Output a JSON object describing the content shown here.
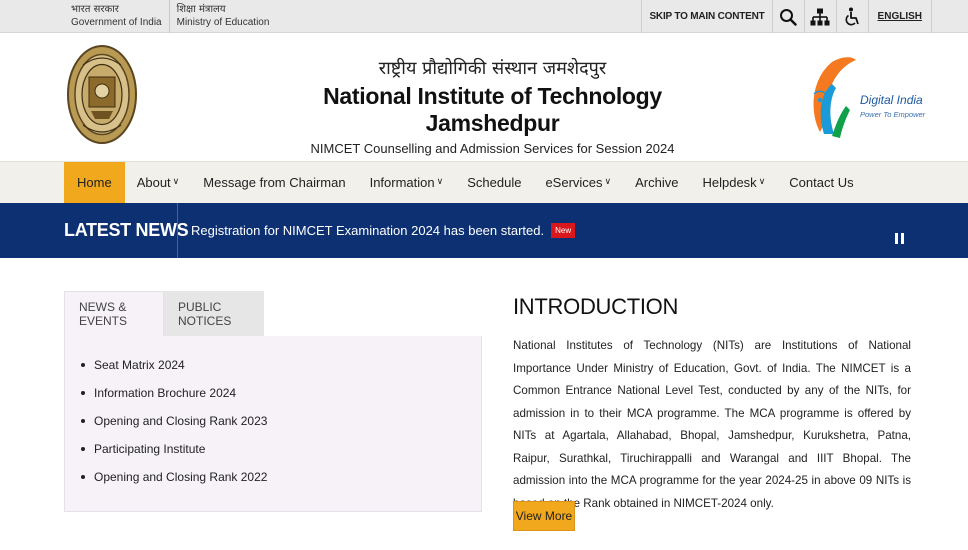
{
  "gov_bar": {
    "gov_hindi": "भारत सरकार",
    "gov_english": "Government of India",
    "ministry_hindi": "शिक्षा मंत्रालय",
    "ministry_english": "Ministry of Education",
    "skip_label": "SKIP TO MAIN CONTENT",
    "icons": [
      "search-icon",
      "sitemap-icon",
      "accessibility-icon"
    ],
    "language_label": "ENGLISH"
  },
  "header": {
    "hindi_title": "राष्ट्रीय प्रौद्योगिकी संस्थान जमशेदपुर",
    "title": "National Institute of Technology Jamshedpur",
    "subtitle": "NIMCET Counselling and Admission Services for Session 2024",
    "digital_india": "Digital India",
    "digital_india_tagline": "Power To Empower"
  },
  "nav": {
    "items": [
      {
        "label": "Home",
        "dropdown": false,
        "active": true
      },
      {
        "label": "About",
        "dropdown": true
      },
      {
        "label": "Message from Chairman",
        "dropdown": false
      },
      {
        "label": "Information",
        "dropdown": true
      },
      {
        "label": "Schedule",
        "dropdown": false
      },
      {
        "label": "eServices",
        "dropdown": true
      },
      {
        "label": "Archive",
        "dropdown": false
      },
      {
        "label": "Helpdesk",
        "dropdown": true
      },
      {
        "label": "Contact Us",
        "dropdown": false
      }
    ]
  },
  "news": {
    "label": "LATEST NEWS",
    "headline": "Registration for NIMCET Examination 2024 has been started.",
    "badge": "New"
  },
  "tabs": {
    "items": [
      {
        "label": "NEWS & EVENTS",
        "active": true
      },
      {
        "label": "PUBLIC NOTICES",
        "active": false
      }
    ]
  },
  "panel": {
    "links": [
      "Seat Matrix 2024",
      "Information Brochure 2024",
      "Opening and Closing Rank 2023",
      "Participating Institute",
      "Opening and Closing Rank 2022"
    ]
  },
  "intro": {
    "title": "INTRODUCTION",
    "text": "National Institutes of Technology (NITs) are Institutions of National Importance Under Ministry of Education, Govt. of India. The NIMCET is a Common Entrance National Level Test, conducted by any of the NITs, for admission in to their MCA programme. The MCA programme is offered by NITs at Agartala, Allahabad, Bhopal, Jamshedpur, Kurukshetra, Patna, Raipur, Surathkal, Tiruchirappalli and Warangal and IIIT Bhopal. The admission into the MCA programme for the year 2024-25 in above 09 NITs is based on the Rank obtained in NIMCET-2024 only.",
    "button_label": "View More"
  },
  "colors": {
    "accent": "#f1a81c",
    "navy": "#0c3071",
    "badge_red": "#d9171c",
    "panel_bg": "#f6f2f8"
  }
}
